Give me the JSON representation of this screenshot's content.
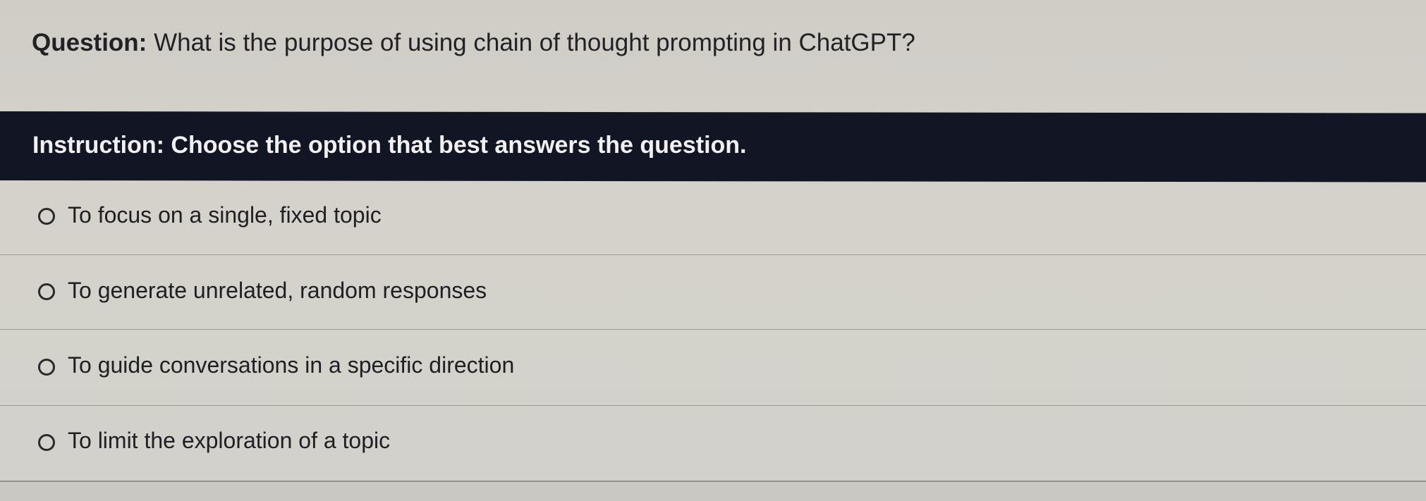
{
  "question": {
    "label": "Question:",
    "text": "What is the purpose of using chain of thought prompting in ChatGPT?"
  },
  "instruction": {
    "text": "Instruction: Choose the option that best answers the question."
  },
  "options": [
    {
      "label": "To focus on a single, fixed topic",
      "selected": false
    },
    {
      "label": "To generate unrelated, random responses",
      "selected": false
    },
    {
      "label": "To guide conversations in a specific direction",
      "selected": false
    },
    {
      "label": "To limit the exploration of a topic",
      "selected": false
    }
  ],
  "colors": {
    "background": "#d2d1cb",
    "instruction_bar": "#111524",
    "instruction_text": "#f1f1f3",
    "text": "#202024",
    "divider": "#9d9d9a"
  }
}
